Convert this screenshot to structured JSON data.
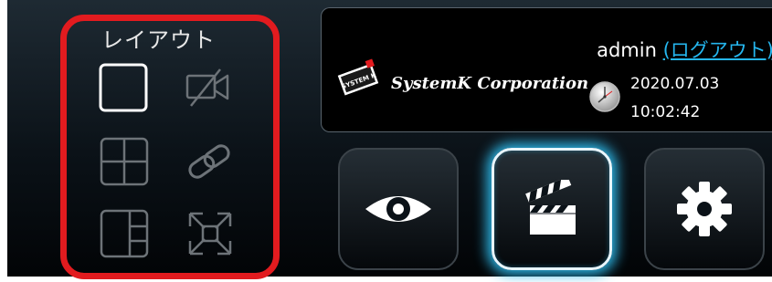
{
  "layout_panel": {
    "title": "レイアウト",
    "buttons": [
      {
        "name": "single-view",
        "icon": "single-square-icon",
        "selected": true
      },
      {
        "name": "camera-off",
        "icon": "camera-off-icon",
        "selected": false
      },
      {
        "name": "quad-view",
        "icon": "quad-grid-icon",
        "selected": false
      },
      {
        "name": "link",
        "icon": "chain-link-icon",
        "selected": false
      },
      {
        "name": "split-view",
        "icon": "split-layout-icon",
        "selected": false
      },
      {
        "name": "fullscreen",
        "icon": "expand-arrows-icon",
        "selected": false
      }
    ],
    "highlight_color": "#e21b1f"
  },
  "header": {
    "username": "admin",
    "logout_label": "(ログアウト)",
    "company_logo_text": "SYSTEM K",
    "company_name": "SystemK Corporation",
    "date": "2020.07.03",
    "time": "10:02:42"
  },
  "mode_buttons": [
    {
      "name": "live-view",
      "icon": "eye-icon",
      "active": false
    },
    {
      "name": "playback",
      "icon": "clapperboard-icon",
      "active": true
    },
    {
      "name": "settings",
      "icon": "gear-icon",
      "active": false
    }
  ],
  "colors": {
    "link": "#25b6ee",
    "active_glow": "#2db8e8",
    "background": "#0b1218"
  }
}
